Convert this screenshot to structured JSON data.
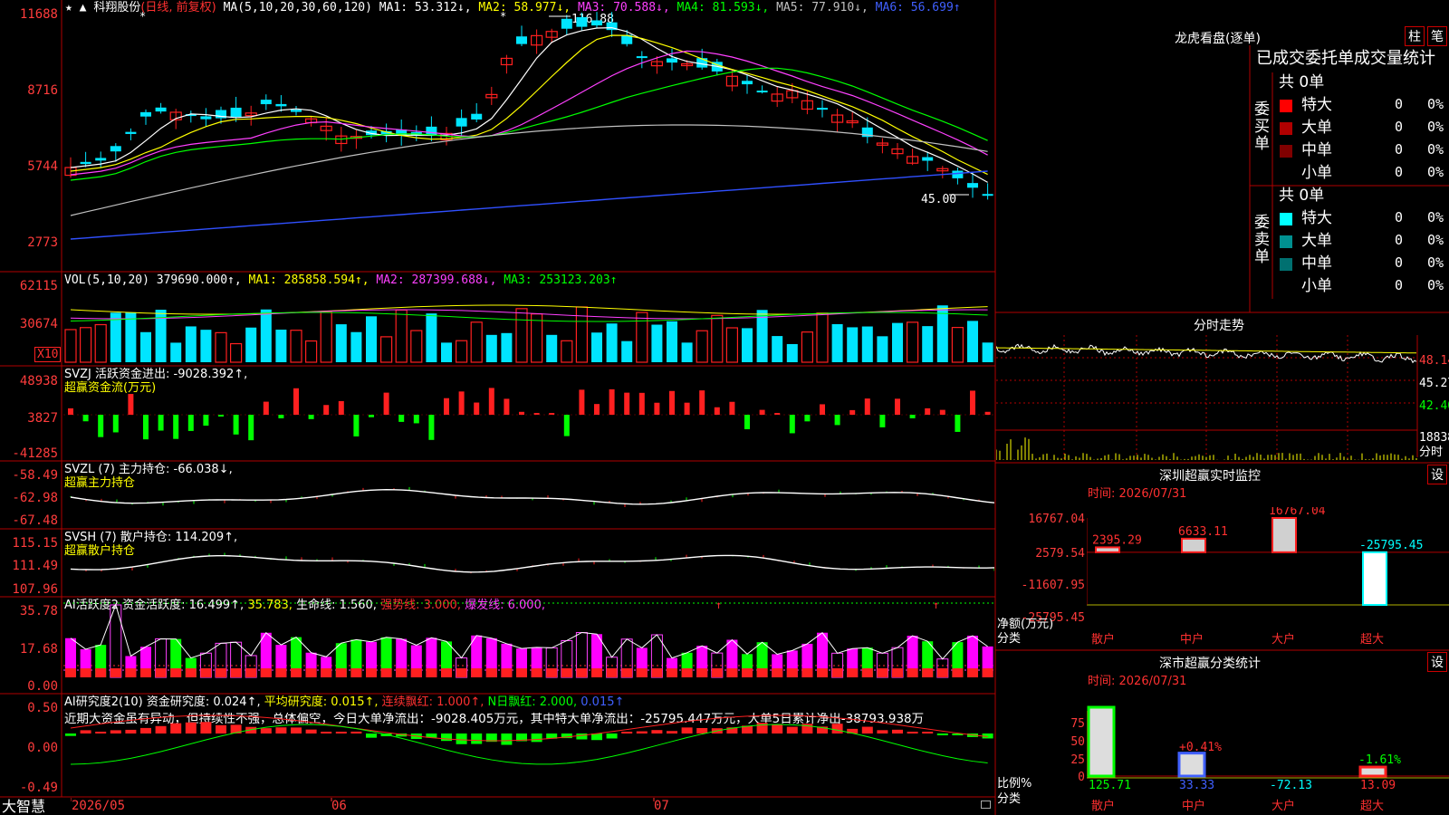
{
  "colors": {
    "up": "#ff2020",
    "down": "#00e5ff",
    "grid": "#b00000",
    "bg": "#000000"
  },
  "main": {
    "stock_name": "科翔股份",
    "mode": "(日线, 前复权)",
    "ma_label": "MA(5,10,20,30,60,120)",
    "ma_values": [
      "MA1: 53.312↓,",
      "MA2: 58.977↓,",
      "MA3: 70.588↓,",
      "MA4: 81.593↓,",
      "MA5: 77.910↓,",
      "MA6: 56.699↑"
    ],
    "ma_colors": [
      "#ffffff",
      "#ffff00",
      "#ff40ff",
      "#00ff00",
      "#c0c0c0",
      "#4060ff"
    ],
    "y_ticks": [
      "11688",
      "8716",
      "5744",
      "2773"
    ],
    "high_label": "116.88",
    "low_label": "45.00"
  },
  "vol": {
    "label": "VOL(5,10,20)",
    "value": "379690.000↑,",
    "ma1": "MA1: 285858.594↑,",
    "ma2": "MA2: 287399.688↓,",
    "ma3": "MA3: 253123.203↑",
    "y_ticks": [
      "62115",
      "30674"
    ],
    "unit": "X10"
  },
  "svzj": {
    "label": "SVZJ",
    "text": "活跃资金进出: -9028.392↑,",
    "subtitle": "超赢资金流(万元)",
    "y_ticks": [
      "48938",
      "3827",
      "-41285"
    ]
  },
  "svzl": {
    "label": "SVZL (7)",
    "text": "主力持仓: -66.038↓,",
    "subtitle": "超赢主力持仓",
    "y_ticks": [
      "-58.49",
      "-62.98",
      "-67.48"
    ]
  },
  "svsh": {
    "label": "SVSH (7)",
    "text": "散户持仓: 114.209↑,",
    "subtitle": "超赢散户持仓",
    "y_ticks": [
      "115.15",
      "111.49",
      "107.96"
    ]
  },
  "ai1": {
    "label": "AI活跃度2",
    "t1": "资金活跃度: 16.499↑,",
    "t2": "35.783,",
    "t3": "生命线: 1.560,",
    "t4": "强势线: 3.000,",
    "t5": "爆发线: 6.000,",
    "y_ticks": [
      "35.78",
      "17.68",
      "0.00"
    ]
  },
  "ai2": {
    "label": "AI研究度2(10)",
    "t1": "资金研究度: 0.024↑,",
    "t2": "平均研究度: 0.015↑,",
    "t3": "连续飘红: 1.000↑,",
    "t4": "N日飘红: 2.000,",
    "t5": "0.015↑",
    "comment": "近期大资金虽有异动，但持续性不强，总体偏空，今日大单净流出：-9028.405万元，其中特大单净流出：-25795.447万元，大单5日累计净出-38793.938万",
    "y_ticks": [
      "0.50",
      "0.00",
      "-0.49"
    ]
  },
  "xaxis": {
    "brand": "大智慧",
    "labels": [
      "2026/05",
      "06",
      "07"
    ]
  },
  "right": {
    "lhb_title": "龙虎看盘(逐单)",
    "btn_zhu": "柱",
    "btn_bi": "笔",
    "stats_title": "已成交委托单成交量统计",
    "buy_side": "委买单",
    "sell_side": "委卖单",
    "buy_total": "共 0单",
    "sell_total": "共 0单",
    "rows": [
      {
        "label": "特大",
        "count": "0",
        "pct": "0%"
      },
      {
        "label": "大单",
        "count": "0",
        "pct": "0%"
      },
      {
        "label": "中单",
        "count": "0",
        "pct": "0%"
      },
      {
        "label": "小单",
        "count": "0",
        "pct": "0%"
      }
    ],
    "buy_colors": [
      "#ff0000",
      "#b00000",
      "#800000",
      "#000000"
    ],
    "sell_colors": [
      "#00ffff",
      "#009090",
      "#007070",
      "#000000"
    ],
    "fenshi_title": "分时走势",
    "fenshi_ticks": [
      "48.14",
      "45.27",
      "42.40",
      "18838",
      "分时"
    ],
    "sz_title": "深圳超赢实时监控",
    "sz_time": "时间: 2026/07/31",
    "set_label": "设",
    "sz_ticks": [
      "16767.04",
      "2579.54",
      "-11607.95",
      "-25795.45"
    ],
    "sz_ylabel": "净额(万元)",
    "sz_xlabel": "分类",
    "sz_cats": [
      "散户",
      "中户",
      "大户",
      "超大"
    ],
    "sz_values": [
      "2395.29",
      "6633.11",
      "16767.04",
      "-25795.45"
    ],
    "fl_title": "深市超赢分类统计",
    "fl_time": "时间: 2026/07/31",
    "fl_ticks": [
      "75",
      "50",
      "25",
      "0"
    ],
    "fl_ylabel": "比例%",
    "fl_xlabel": "分类",
    "fl_cats": [
      "散户",
      "中户",
      "大户",
      "超大"
    ],
    "fl_values": [
      "125.71",
      "33.33",
      "-72.13",
      "13.09"
    ],
    "fl_pcts": [
      "+0.41%",
      "-1.61%"
    ]
  }
}
